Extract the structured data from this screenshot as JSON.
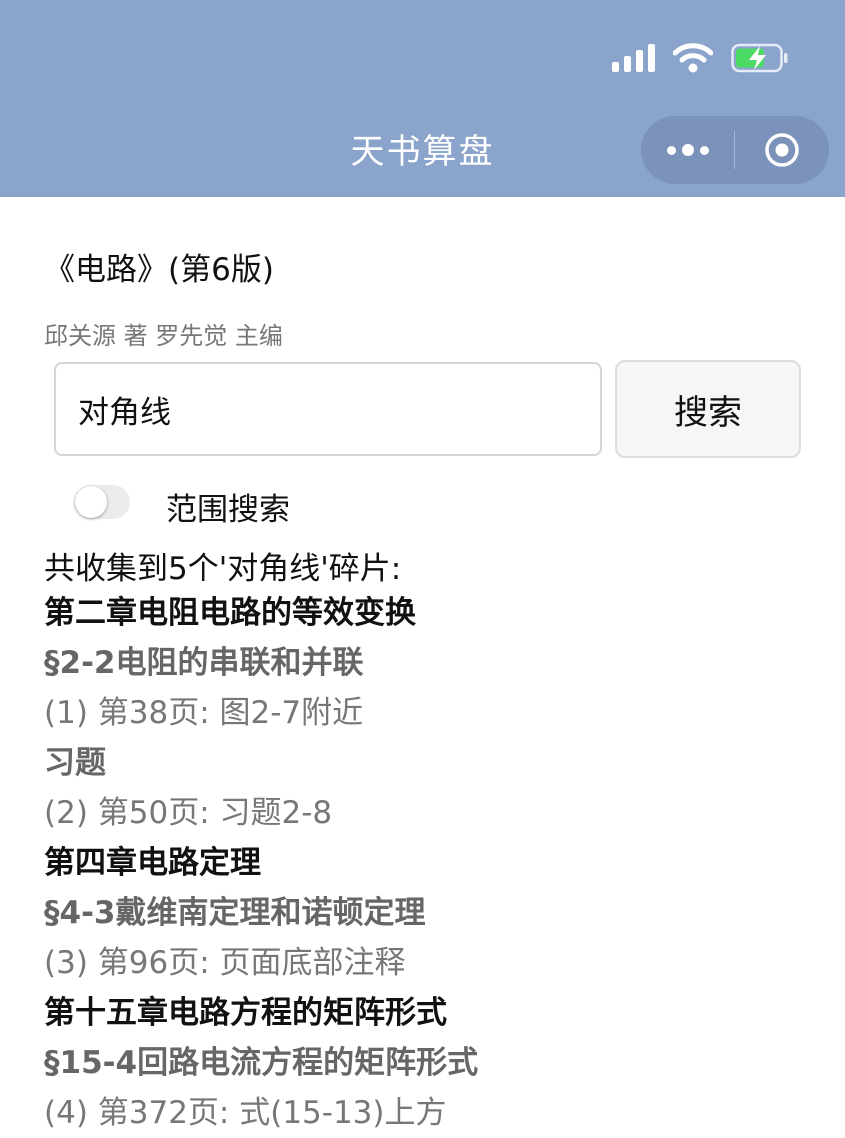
{
  "nav": {
    "title": "天书算盘"
  },
  "book": {
    "title": "《电路》(第6版)",
    "authors": "邱关源 著 罗先觉 主编"
  },
  "search": {
    "value": "对角线",
    "button_label": "搜索"
  },
  "range_search": {
    "label": "范围搜索",
    "enabled": false
  },
  "summary": "共收集到5个'对角线'碎片:",
  "results": [
    {
      "type": "chapter",
      "text": "第二章电阻电路的等效变换"
    },
    {
      "type": "section",
      "text": "§2-2电阻的串联和并联"
    },
    {
      "type": "page",
      "text": "(1) 第38页: 图2-7附近"
    },
    {
      "type": "section",
      "text": "习题"
    },
    {
      "type": "page",
      "text": "(2) 第50页: 习题2-8"
    },
    {
      "type": "chapter",
      "text": "第四章电路定理"
    },
    {
      "type": "section",
      "text": "§4-3戴维南定理和诺顿定理"
    },
    {
      "type": "page",
      "text": "(3) 第96页: 页面底部注释"
    },
    {
      "type": "chapter",
      "text": "第十五章电路方程的矩阵形式"
    },
    {
      "type": "section",
      "text": "§15-4回路电流方程的矩阵形式"
    },
    {
      "type": "page",
      "text": "(4) 第372页: 式(15-13)上方"
    }
  ],
  "colors": {
    "nav_bar": "#8aa4cc",
    "battery_charging": "#4cd964"
  }
}
